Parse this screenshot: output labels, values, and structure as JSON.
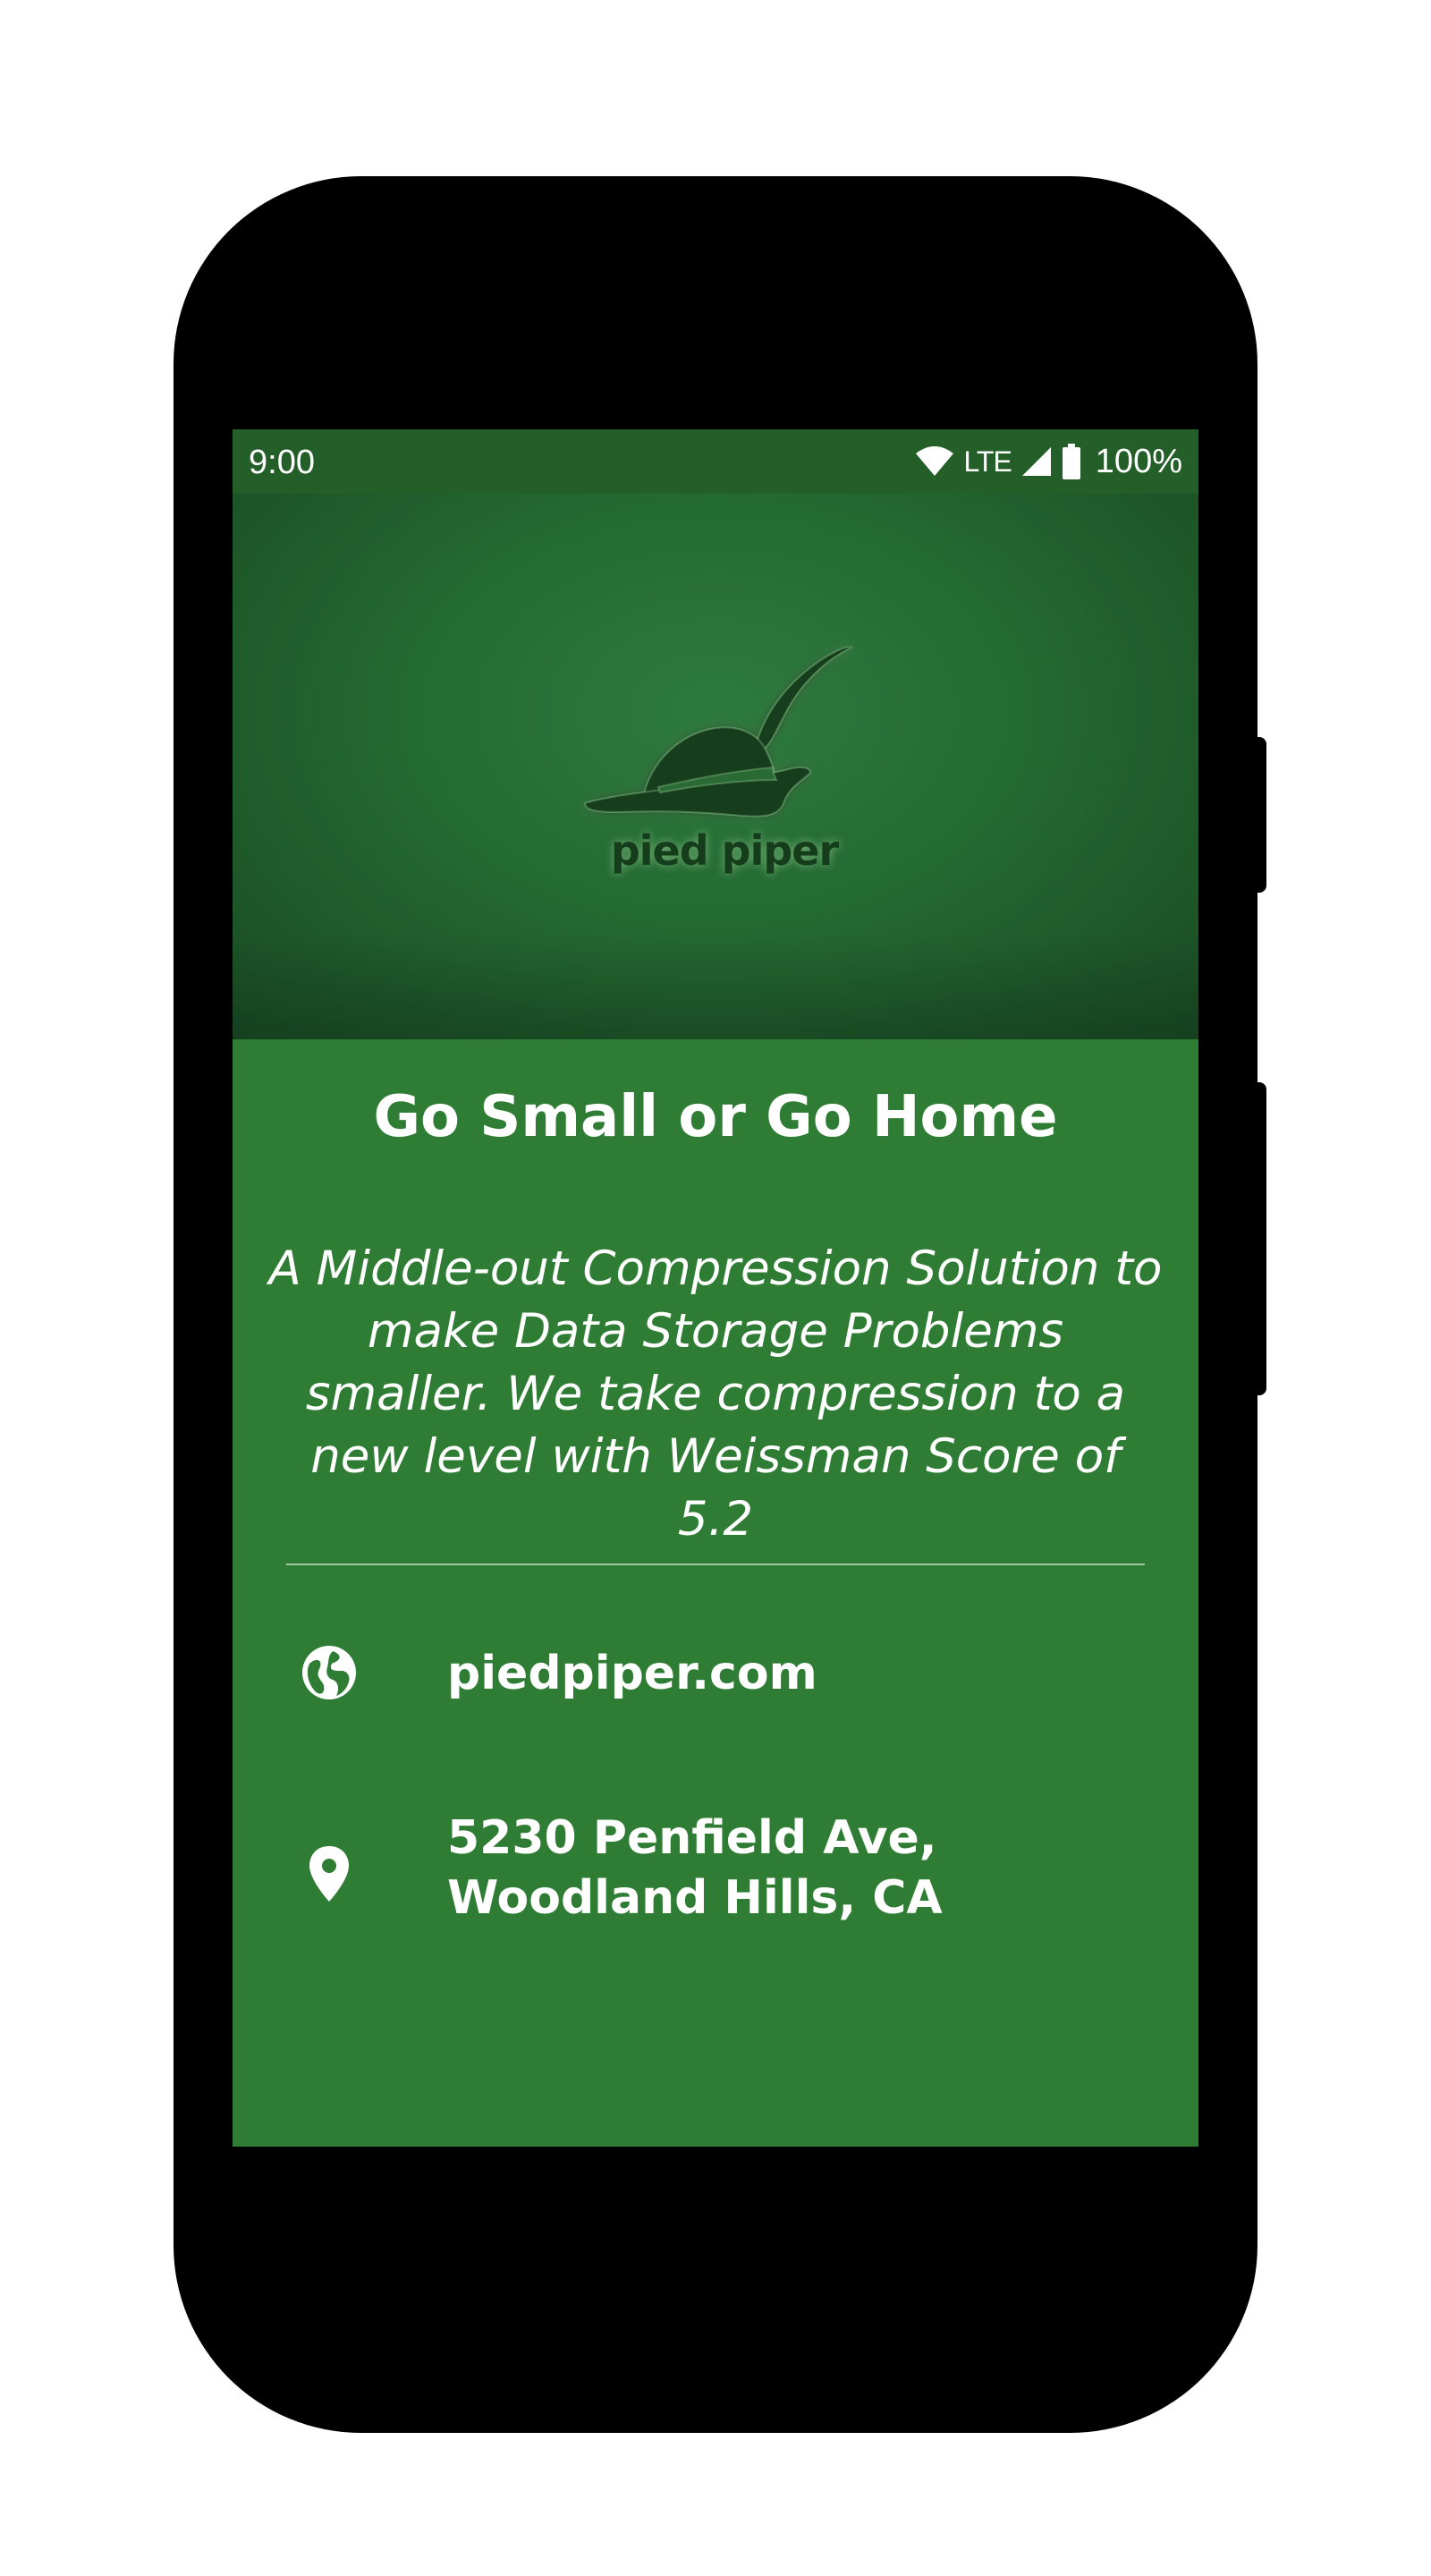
{
  "status_bar": {
    "time": "9:00",
    "network": "LTE",
    "battery": "100%"
  },
  "header": {
    "logo_text": "pied piper",
    "background_color": "#246a33"
  },
  "card": {
    "title": "Go Small or Go Home",
    "description": "A Middle-out Compression Solution to make Data Storage Problems smaller. We take compression to a new level with Weissman Score of 5.2",
    "background_color": "#2f7d34"
  },
  "contact": {
    "website": "piedpiper.com",
    "address": "5230 Penfield Ave, Woodland Hills, CA"
  },
  "icons": {
    "website": "globe-icon",
    "address": "location-pin-icon"
  }
}
